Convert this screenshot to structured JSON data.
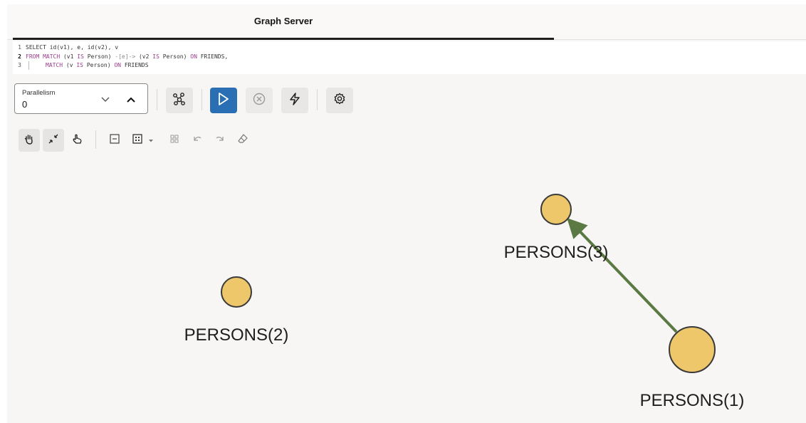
{
  "tab": {
    "title": "Graph Server"
  },
  "editor": {
    "lines": [
      {
        "num": "1",
        "tokens": [
          {
            "t": "SELECT id(v1), e, id(v2), v",
            "c": "code"
          }
        ]
      },
      {
        "num": "2",
        "tokens": [
          {
            "t": "FROM MATCH",
            "c": "kw"
          },
          {
            "t": " (v1 ",
            "c": "code"
          },
          {
            "t": "IS",
            "c": "kw"
          },
          {
            "t": " Person) ",
            "c": "code"
          },
          {
            "t": "-[e]->",
            "c": "op"
          },
          {
            "t": " (v2 ",
            "c": "code"
          },
          {
            "t": "IS",
            "c": "kw"
          },
          {
            "t": " Person) ",
            "c": "code"
          },
          {
            "t": "ON",
            "c": "kw"
          },
          {
            "t": " FRIENDS,",
            "c": "code"
          }
        ]
      },
      {
        "num": "3",
        "indent": true,
        "tokens": [
          {
            "t": "MATCH",
            "c": "kw"
          },
          {
            "t": " (v ",
            "c": "code"
          },
          {
            "t": "IS",
            "c": "kw"
          },
          {
            "t": " Person) ",
            "c": "code"
          },
          {
            "t": "ON",
            "c": "kw"
          },
          {
            "t": " FRIENDS",
            "c": "code"
          }
        ]
      }
    ]
  },
  "toolbar": {
    "parallelism_label": "Parallelism",
    "parallelism_value": "0",
    "buttons": [
      "graph-settings-icon",
      "run-icon",
      "cancel-icon",
      "flash-icon",
      "settings-gear-icon"
    ]
  },
  "graph_tools": [
    "pan-hand-icon",
    "fit-screen-icon",
    "select-hand-icon",
    "collapse-icon",
    "layout-grid-icon",
    "layout-options-icon",
    "undo-icon",
    "redo-icon",
    "eraser-icon"
  ],
  "graph": {
    "nodes": [
      {
        "id": "p3",
        "label": "PERSONS(3)"
      },
      {
        "id": "p2",
        "label": "PERSONS(2)"
      },
      {
        "id": "p1",
        "label": "PERSONS(1)"
      }
    ],
    "edges": [
      {
        "from": "p1",
        "to": "p3"
      }
    ],
    "colors": {
      "node_fill": "#eec76b",
      "node_stroke": "#3a3a3a",
      "edge": "#5b7a43",
      "accent": "#2a6fb3"
    }
  }
}
